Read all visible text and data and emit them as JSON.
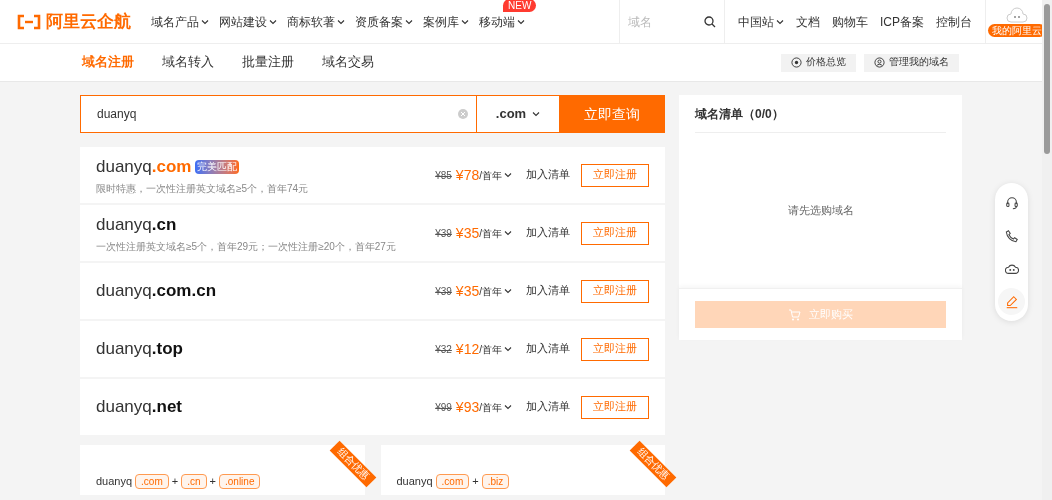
{
  "logo": {
    "text": "阿里云企航"
  },
  "nav": [
    {
      "label": "域名产品",
      "has_menu": true
    },
    {
      "label": "网站建设",
      "has_menu": true
    },
    {
      "label": "商标软著",
      "has_menu": true
    },
    {
      "label": "资质备案",
      "has_menu": true
    },
    {
      "label": "案例库",
      "has_menu": true
    },
    {
      "label": "移动端",
      "has_menu": true,
      "badge": "NEW"
    }
  ],
  "header_search": {
    "placeholder": "域名"
  },
  "right_links": [
    {
      "label": "中国站",
      "has_menu": true
    },
    {
      "label": "文档",
      "has_menu": false
    },
    {
      "label": "购物车",
      "has_menu": false
    },
    {
      "label": "ICP备案",
      "has_menu": false
    },
    {
      "label": "控制台",
      "has_menu": false
    }
  ],
  "user": {
    "label": "我的阿里云"
  },
  "tabs": [
    {
      "label": "域名注册",
      "selected": true
    },
    {
      "label": "域名转入",
      "selected": false
    },
    {
      "label": "批量注册",
      "selected": false
    },
    {
      "label": "域名交易",
      "selected": false
    }
  ],
  "tools": [
    {
      "label": "价格总览"
    },
    {
      "label": "管理我的域名"
    }
  ],
  "search": {
    "value": "duanyq",
    "suffix": ".com",
    "button": "立即查询"
  },
  "results": [
    {
      "name": "duanyq",
      "tld": ".com",
      "matched": true,
      "badge": "完美匹配",
      "note": "限时特惠，一次性注册英文域名≥5个，首年74元",
      "old_price": "¥85",
      "price": "¥78",
      "unit": "/首年",
      "add": "加入清单",
      "register": "立即注册"
    },
    {
      "name": "duanyq",
      "tld": ".cn",
      "matched": false,
      "note": "一次性注册英文域名≥5个，首年29元；一次性注册≥20个，首年27元",
      "old_price": "¥39",
      "price": "¥35",
      "unit": "/首年",
      "add": "加入清单",
      "register": "立即注册"
    },
    {
      "name": "duanyq",
      "tld": ".com.cn",
      "matched": false,
      "old_price": "¥39",
      "price": "¥35",
      "unit": "/首年",
      "add": "加入清单",
      "register": "立即注册"
    },
    {
      "name": "duanyq",
      "tld": ".top",
      "matched": false,
      "old_price": "¥32",
      "price": "¥12",
      "unit": "/首年",
      "add": "加入清单",
      "register": "立即注册"
    },
    {
      "name": "duanyq",
      "tld": ".net",
      "matched": false,
      "old_price": "¥99",
      "price": "¥93",
      "unit": "/首年",
      "add": "加入清单",
      "register": "立即注册"
    }
  ],
  "combos": [
    {
      "name": "duanyq",
      "ribbon": "组合优惠",
      "tlds": [
        ".com",
        ".cn",
        ".online"
      ],
      "plus": "+"
    },
    {
      "name": "duanyq",
      "ribbon": "组合优惠",
      "tlds": [
        ".com",
        ".biz"
      ],
      "plus": "+"
    }
  ],
  "cart": {
    "title": "域名清单（0/0）",
    "empty": "请先选购域名",
    "buy": "立即购买",
    "disabled": true
  },
  "float_tools": [
    {
      "active": false
    },
    {
      "active": false
    },
    {
      "active": false
    },
    {
      "active": true
    }
  ]
}
